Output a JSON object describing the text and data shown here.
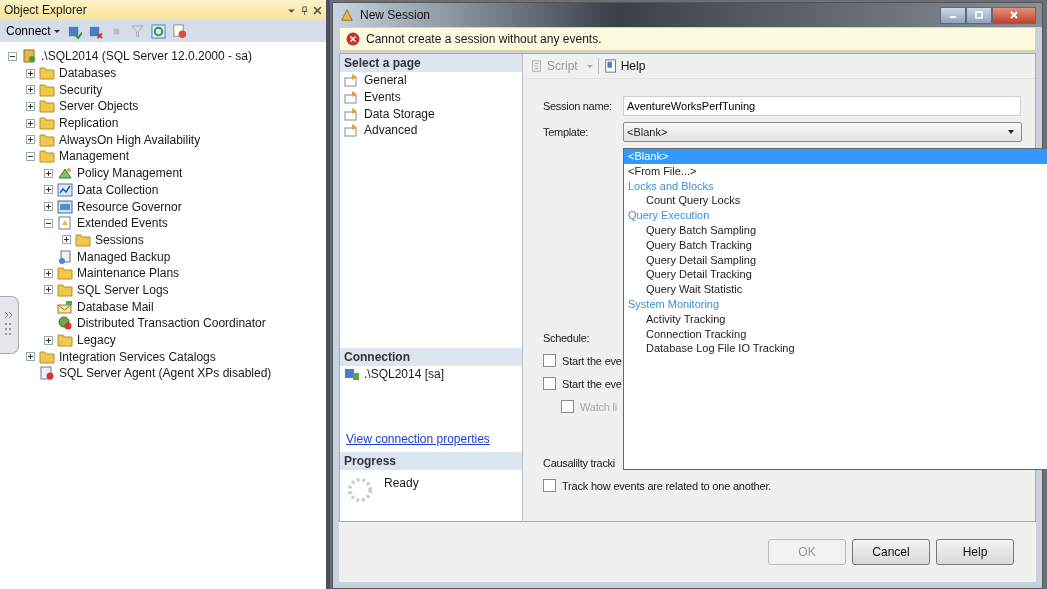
{
  "object_explorer": {
    "title": "Object Explorer",
    "toolbar": {
      "connect": "Connect"
    },
    "tree": [
      {
        "label": ".\\SQL2014 (SQL Server 12.0.2000 - sa)",
        "kind": "server",
        "expander": true,
        "expanded": true,
        "children": [
          {
            "label": "Databases",
            "kind": "folder",
            "expander": true,
            "expanded": false
          },
          {
            "label": "Security",
            "kind": "folder",
            "expander": true,
            "expanded": false
          },
          {
            "label": "Server Objects",
            "kind": "folder",
            "expander": true,
            "expanded": false
          },
          {
            "label": "Replication",
            "kind": "folder",
            "expander": true,
            "expanded": false
          },
          {
            "label": "AlwaysOn High Availability",
            "kind": "folder",
            "expander": true,
            "expanded": false
          },
          {
            "label": "Management",
            "kind": "folder",
            "expander": true,
            "expanded": true,
            "children": [
              {
                "label": "Policy Management",
                "kind": "policy",
                "expander": true,
                "expanded": false
              },
              {
                "label": "Data Collection",
                "kind": "chart",
                "expander": true,
                "expanded": false
              },
              {
                "label": "Resource Governor",
                "kind": "window",
                "expander": true,
                "expanded": false
              },
              {
                "label": "Extended Events",
                "kind": "document",
                "expander": true,
                "expanded": true,
                "children": [
                  {
                    "label": "Sessions",
                    "kind": "folder",
                    "expander": true,
                    "expanded": false
                  }
                ]
              },
              {
                "label": "Managed Backup",
                "kind": "backup",
                "expander": false
              },
              {
                "label": "Maintenance Plans",
                "kind": "folder",
                "expander": true,
                "expanded": false
              },
              {
                "label": "SQL Server Logs",
                "kind": "folder",
                "expander": true,
                "expanded": false
              },
              {
                "label": "Database Mail",
                "kind": "mail",
                "expander": false
              },
              {
                "label": "Distributed Transaction Coordinator",
                "kind": "dtc",
                "expander": false
              },
              {
                "label": "Legacy",
                "kind": "folder",
                "expander": true,
                "expanded": false
              }
            ]
          },
          {
            "label": "Integration Services Catalogs",
            "kind": "folder",
            "expander": true,
            "expanded": false
          },
          {
            "label": "SQL Server Agent (Agent XPs disabled)",
            "kind": "agent",
            "expander": false
          }
        ]
      }
    ]
  },
  "dialog": {
    "title": "New Session",
    "error": "Cannot create a session without any events.",
    "select_page": {
      "heading": "Select a page",
      "items": [
        "General",
        "Events",
        "Data Storage",
        "Advanced"
      ]
    },
    "connection": {
      "heading": "Connection",
      "server": ".\\SQL2014 [sa]",
      "link": "View connection properties"
    },
    "progress": {
      "heading": "Progress",
      "status": "Ready"
    },
    "toolbar": {
      "script": "Script",
      "script_disabled": true,
      "help": "Help"
    },
    "session_name": {
      "label": "Session name:",
      "value": "AventureWorksPerfTuning"
    },
    "template": {
      "label": "Template:",
      "value": "<Blank>",
      "options": [
        {
          "label": "<Blank>",
          "kind": "option",
          "selected": true
        },
        {
          "label": "<From File...>",
          "kind": "option",
          "selected": false
        },
        {
          "label": "Locks and Blocks",
          "kind": "group",
          "selected": false
        },
        {
          "label": "Count Query Locks",
          "kind": "sub",
          "selected": false
        },
        {
          "label": "Query Execution",
          "kind": "group",
          "selected": false
        },
        {
          "label": "Query Batch Sampling",
          "kind": "sub",
          "selected": false
        },
        {
          "label": "Query Batch Tracking",
          "kind": "sub",
          "selected": false
        },
        {
          "label": "Query Detail Sampling",
          "kind": "sub",
          "selected": false
        },
        {
          "label": "Query Detail Tracking",
          "kind": "sub",
          "selected": false
        },
        {
          "label": "Query Wait Statistic",
          "kind": "sub",
          "selected": false
        },
        {
          "label": "System Monitoring",
          "kind": "group",
          "selected": false
        },
        {
          "label": "Activity Tracking",
          "kind": "sub",
          "selected": false
        },
        {
          "label": "Connection Tracking",
          "kind": "sub",
          "selected": false
        },
        {
          "label": "Database Log File IO Tracking",
          "kind": "sub",
          "selected": false
        }
      ]
    },
    "schedule": {
      "label": "Schedule:",
      "options": [
        {
          "label": "Start the eve",
          "checked": false,
          "disabled": false
        },
        {
          "label": "Start the eve",
          "checked": false,
          "disabled": false,
          "children": [
            {
              "label": "Watch li",
              "checked": false,
              "disabled": true
            }
          ]
        }
      ]
    },
    "causality": {
      "label": "Causalilty tracki",
      "option": {
        "label": "Track how events are related to one another.",
        "checked": false
      }
    },
    "buttons": [
      {
        "label": "OK",
        "disabled": true
      },
      {
        "label": "Cancel",
        "disabled": false
      },
      {
        "label": "Help",
        "disabled": false
      }
    ]
  }
}
